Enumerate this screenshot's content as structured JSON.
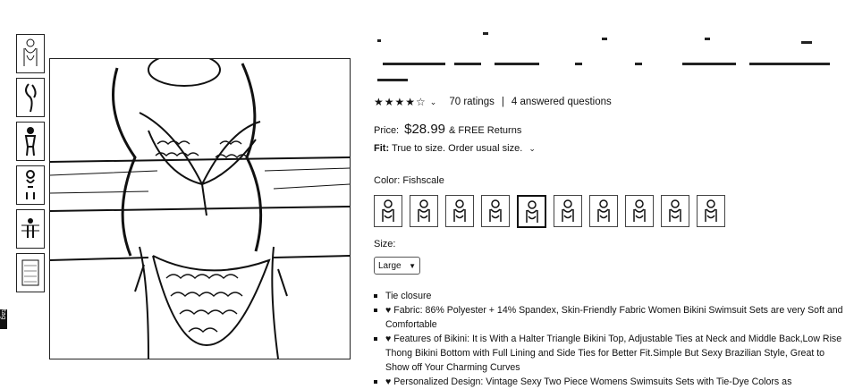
{
  "thumbnails": [
    "thumb-1",
    "thumb-2",
    "thumb-3",
    "thumb-4",
    "thumb-5",
    "thumb-6"
  ],
  "side_tag": "tag",
  "rating": {
    "stars": "★★★★☆",
    "count_label": "70 ratings",
    "separator": "|",
    "questions_label": "4 answered questions"
  },
  "price": {
    "label": "Price:",
    "value": "$28.99",
    "shipping": "& FREE Returns"
  },
  "fit": {
    "label": "Fit:",
    "value": "True to size. Order usual size."
  },
  "color": {
    "label": "Color:",
    "value": "Fishscale",
    "swatch_count": 10,
    "selected_index": 4
  },
  "size": {
    "label": "Size:",
    "selected": "Large"
  },
  "bullets": [
    "Tie closure",
    "♥ Fabric: 86% Polyester + 14% Spandex, Skin-Friendly Fabric Women Bikini Swimsuit Sets are very Soft and Comfortable",
    "♥ Features of Bikini: It is With a Halter Triangle Bikini Top, Adjustable Ties at Neck and Middle Back,Low Rise Thong Bikini Bottom with Full Lining and Side Ties for Better Fit.Simple But Sexy Brazilian Style, Great to Show off Your Charming Curves",
    "♥ Personalized Design: Vintage Sexy Two Piece Womens Swimsuits Sets with Tie-Dye Colors as"
  ]
}
